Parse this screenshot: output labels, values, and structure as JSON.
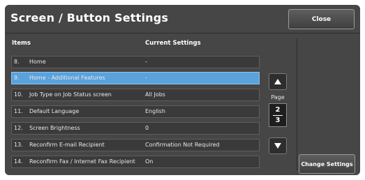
{
  "header": {
    "title": "Screen / Button Settings",
    "close_label": "Close"
  },
  "columns": {
    "items": "Items",
    "current_settings": "Current Settings"
  },
  "rows": [
    {
      "num": "8.",
      "name": "Home",
      "value": "-",
      "selected": false
    },
    {
      "num": "9.",
      "name": "Home - Additional Features",
      "value": "-",
      "selected": true
    },
    {
      "num": "10.",
      "name": "Job Type on Job Status screen",
      "value": "All Jobs",
      "selected": false
    },
    {
      "num": "11.",
      "name": "Default Language",
      "value": "English",
      "selected": false
    },
    {
      "num": "12.",
      "name": "Screen Brightness",
      "value": "0",
      "selected": false
    },
    {
      "num": "13.",
      "name": "Reconfirm E-mail Recipient",
      "value": "Confirmation Not Required",
      "selected": false
    },
    {
      "num": "14.",
      "name": "Reconfirm Fax / Internet Fax Recipient",
      "value": "On",
      "selected": false
    }
  ],
  "pager": {
    "label": "Page",
    "current": "2",
    "total": "3"
  },
  "actions": {
    "change_label": "Change Settings"
  },
  "colors": {
    "background": "#464646",
    "selected_row": "#5aa2dc"
  }
}
